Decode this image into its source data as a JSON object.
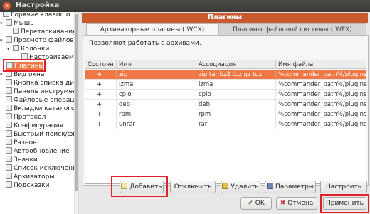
{
  "window": {
    "title": "Настройка"
  },
  "sidebar": {
    "items": [
      {
        "label": "Горячие клавиши",
        "icon": "keyboard-icon"
      },
      {
        "label": "Мышь",
        "icon": "mouse-icon"
      },
      {
        "label": "Перетаскивание",
        "icon": "drag-icon"
      },
      {
        "label": "Просмотр файлов",
        "icon": "folder-view-icon"
      },
      {
        "label": "Колонки",
        "icon": "columns-icon"
      },
      {
        "label": "Настраиваемые",
        "icon": "custom-columns-icon"
      },
      {
        "label": "Плагины",
        "icon": "plugins-icon",
        "selected": true
      },
      {
        "label": "Вид окна",
        "icon": "window-icon"
      },
      {
        "label": "Кнопка списка ди",
        "icon": "drive-button-icon"
      },
      {
        "label": "Панель инструмент",
        "icon": "toolbar-icon"
      },
      {
        "label": "Файловые операци",
        "icon": "file-ops-icon"
      },
      {
        "label": "Вкладки каталогов",
        "icon": "tabs-icon"
      },
      {
        "label": "Протокол",
        "icon": "log-icon"
      },
      {
        "label": "Конфигурация",
        "icon": "config-icon"
      },
      {
        "label": "Быстрый поиск/фил",
        "icon": "search-icon"
      },
      {
        "label": "Разное",
        "icon": "misc-icon"
      },
      {
        "label": "Автообновление",
        "icon": "refresh-icon"
      },
      {
        "label": "Значки",
        "icon": "icons-icon"
      },
      {
        "label": "Список исключений",
        "icon": "ignore-list-icon"
      },
      {
        "label": "Архиваторы",
        "icon": "archive-icon"
      },
      {
        "label": "Подсказки",
        "icon": "tooltip-icon"
      }
    ]
  },
  "section": {
    "title": "Плагины"
  },
  "tabs": [
    {
      "label": "Архиваторные плагины (.WCX)",
      "active": true
    },
    {
      "label": "Плагины файловой системы (.WFX)",
      "active": false
    }
  ],
  "description": "Позволяют работать с архивами.",
  "table": {
    "headers": [
      "Состоян",
      "Имя",
      "Ассоциация",
      "Имя файла"
    ],
    "rows": [
      {
        "state": "+",
        "name": "zip",
        "assoc": "zip tar bz2 tbz gz tgz",
        "file": "%commander_path%/plugins/wc",
        "selected": true
      },
      {
        "state": "+",
        "name": "lzma",
        "assoc": "lzma",
        "file": "%commander_path%/plugins/wc"
      },
      {
        "state": "+",
        "name": "cpio",
        "assoc": "cpio",
        "file": "%commander_path%/plugins/wc"
      },
      {
        "state": "+",
        "name": "deb",
        "assoc": "deb",
        "file": "%commander_path%/plugins/wc"
      },
      {
        "state": "+",
        "name": "rpm",
        "assoc": "rpm",
        "file": "%commander_path%/plugins/wc"
      },
      {
        "state": "+",
        "name": "unrar",
        "assoc": "rar",
        "file": "%commander_path%/plugins/wc"
      }
    ]
  },
  "plugin_buttons": {
    "add": "Добавить",
    "disable": "Отключить",
    "remove": "Удалить",
    "params": "Параметры",
    "configure": "Настроить"
  },
  "dialog_buttons": {
    "ok": "OK",
    "cancel": "Отмена",
    "apply": "Применить"
  },
  "colors": {
    "selection": "#f07746",
    "section_header": "#c9592e",
    "highlight_box": "#e0202a"
  }
}
